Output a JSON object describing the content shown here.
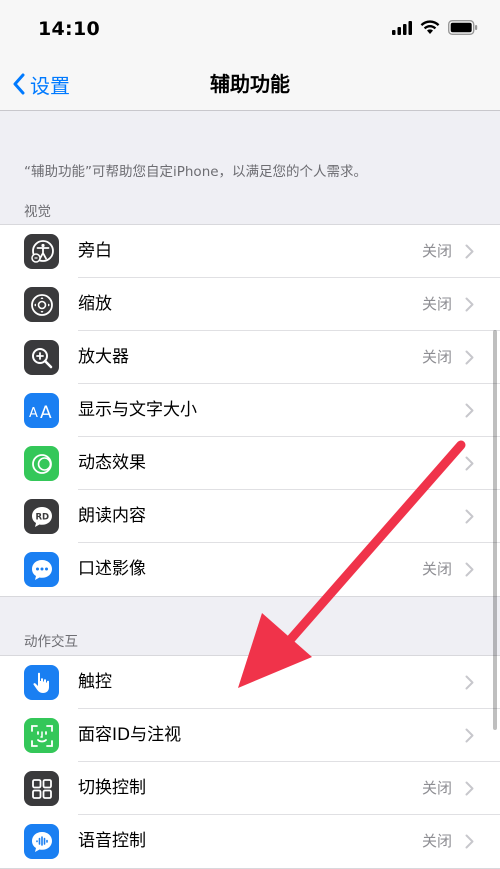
{
  "status_bar": {
    "time": "14:10"
  },
  "nav": {
    "back_label": "设置",
    "title": "辅助功能"
  },
  "description": "“辅助功能”可帮助您自定iPhone，以满足您的个人需求。",
  "sections": [
    {
      "header": "视觉",
      "items": [
        {
          "label": "旁白",
          "value": "关闭",
          "icon": "voiceover-icon",
          "color": "#3a3a3c"
        },
        {
          "label": "缩放",
          "value": "关闭",
          "icon": "zoom-icon",
          "color": "#3a3a3c"
        },
        {
          "label": "放大器",
          "value": "关闭",
          "icon": "magnifier-icon",
          "color": "#3a3a3c"
        },
        {
          "label": "显示与文字大小",
          "value": "",
          "icon": "text-size-icon",
          "color": "#1a7ff2"
        },
        {
          "label": "动态效果",
          "value": "",
          "icon": "motion-icon",
          "color": "#34c759"
        },
        {
          "label": "朗读内容",
          "value": "",
          "icon": "spoken-content-icon",
          "color": "#3a3a3c"
        },
        {
          "label": "口述影像",
          "value": "关闭",
          "icon": "audio-description-icon",
          "color": "#1a7ff2"
        }
      ]
    },
    {
      "header": "动作交互",
      "items": [
        {
          "label": "触控",
          "value": "",
          "icon": "touch-icon",
          "color": "#1a7ff2"
        },
        {
          "label": "面容ID与注视",
          "value": "",
          "icon": "face-id-icon",
          "color": "#34c759"
        },
        {
          "label": "切换控制",
          "value": "关闭",
          "icon": "switch-control-icon",
          "color": "#3a3a3c"
        },
        {
          "label": "语音控制",
          "value": "关闭",
          "icon": "voice-control-icon",
          "color": "#1a7ff2"
        }
      ]
    }
  ],
  "colors": {
    "accent": "#007aff",
    "annotation_arrow": "#f0334a"
  }
}
